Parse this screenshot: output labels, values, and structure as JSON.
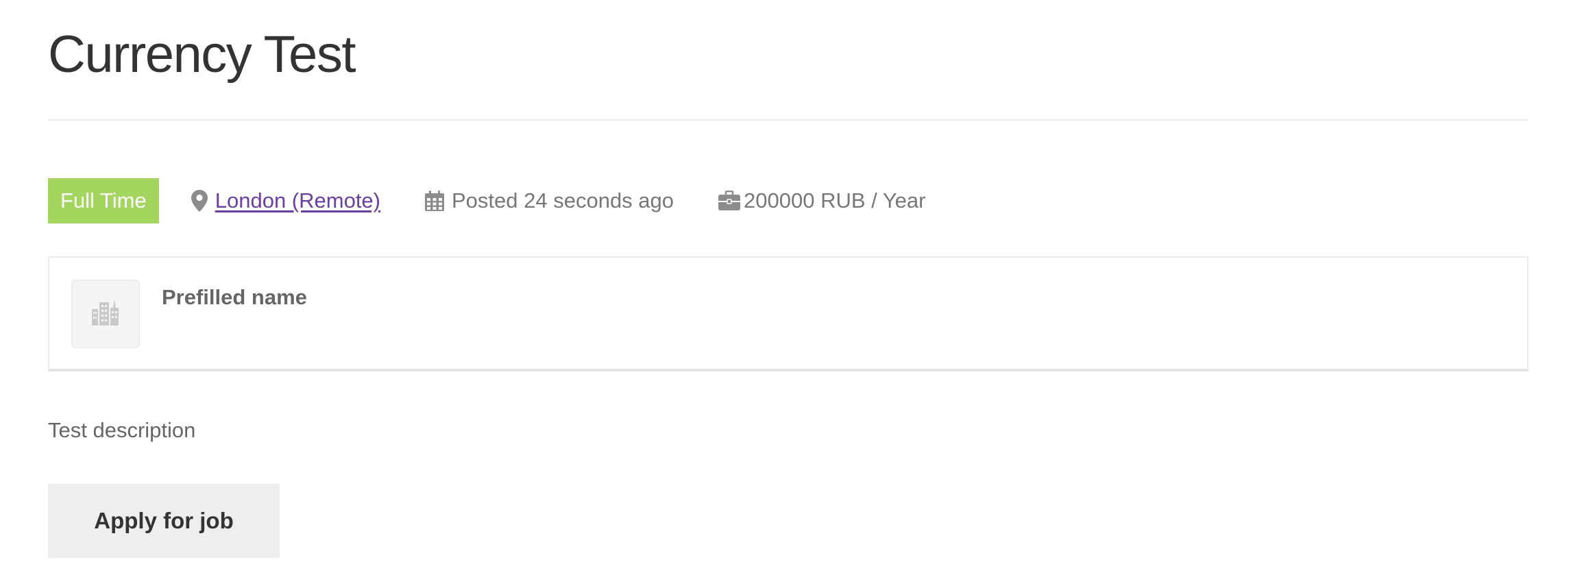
{
  "job": {
    "title": "Currency Test",
    "type_badge": "Full Time",
    "location": "London (Remote)",
    "posted": "Posted 24 seconds ago",
    "salary": "200000 RUB / Year",
    "description": "Test description"
  },
  "company": {
    "name": "Prefilled name",
    "logo_icon": "company-building-icon"
  },
  "actions": {
    "apply_label": "Apply for job"
  },
  "icons": {
    "location": "map-pin-icon",
    "date": "calendar-icon",
    "salary": "briefcase-icon"
  },
  "colors": {
    "badge_background": "#a3d55f",
    "link": "#6b3fa0",
    "button_background": "#eeeeee"
  }
}
